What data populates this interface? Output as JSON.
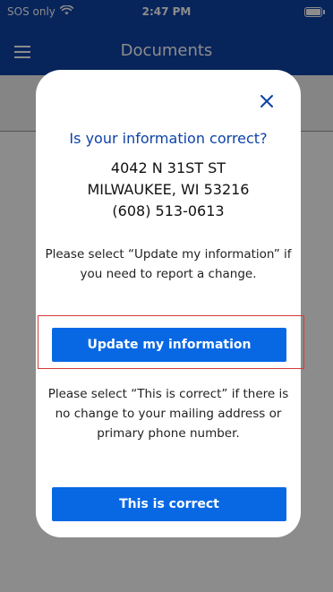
{
  "status_bar": {
    "carrier": "SOS only",
    "time": "2:47 PM",
    "icons": [
      "wifi-icon",
      "battery-icon"
    ]
  },
  "header": {
    "title": "Documents",
    "menu_icon": "hamburger-menu-icon"
  },
  "dialog": {
    "close_icon": "close-icon",
    "title": "Is your information correct?",
    "address_line1": "4042 N 31ST ST",
    "address_line2": "MILWAUKEE, WI 53216",
    "phone": "(608) 513-0613",
    "update_message": "Please select “Update my information” if you need to report a change.",
    "update_button_label": "Update my information",
    "correct_message": "Please select “This is correct” if there is no change to your mailing address or primary phone number.",
    "correct_button_label": "This is correct"
  },
  "colors": {
    "brand_blue": "#0d43a7",
    "button_blue": "#0868e4",
    "highlight_red": "#d43a3a"
  }
}
